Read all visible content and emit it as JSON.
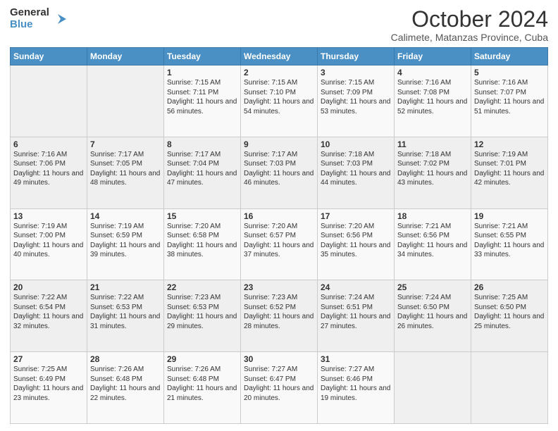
{
  "logo": {
    "line1": "General",
    "line2": "Blue",
    "icon_color": "#4a90c4"
  },
  "header": {
    "month": "October 2024",
    "location": "Calimete, Matanzas Province, Cuba"
  },
  "weekdays": [
    "Sunday",
    "Monday",
    "Tuesday",
    "Wednesday",
    "Thursday",
    "Friday",
    "Saturday"
  ],
  "weeks": [
    [
      {
        "day": "",
        "info": ""
      },
      {
        "day": "",
        "info": ""
      },
      {
        "day": "1",
        "info": "Sunrise: 7:15 AM\nSunset: 7:11 PM\nDaylight: 11 hours and 56 minutes."
      },
      {
        "day": "2",
        "info": "Sunrise: 7:15 AM\nSunset: 7:10 PM\nDaylight: 11 hours and 54 minutes."
      },
      {
        "day": "3",
        "info": "Sunrise: 7:15 AM\nSunset: 7:09 PM\nDaylight: 11 hours and 53 minutes."
      },
      {
        "day": "4",
        "info": "Sunrise: 7:16 AM\nSunset: 7:08 PM\nDaylight: 11 hours and 52 minutes."
      },
      {
        "day": "5",
        "info": "Sunrise: 7:16 AM\nSunset: 7:07 PM\nDaylight: 11 hours and 51 minutes."
      }
    ],
    [
      {
        "day": "6",
        "info": "Sunrise: 7:16 AM\nSunset: 7:06 PM\nDaylight: 11 hours and 49 minutes."
      },
      {
        "day": "7",
        "info": "Sunrise: 7:17 AM\nSunset: 7:05 PM\nDaylight: 11 hours and 48 minutes."
      },
      {
        "day": "8",
        "info": "Sunrise: 7:17 AM\nSunset: 7:04 PM\nDaylight: 11 hours and 47 minutes."
      },
      {
        "day": "9",
        "info": "Sunrise: 7:17 AM\nSunset: 7:03 PM\nDaylight: 11 hours and 46 minutes."
      },
      {
        "day": "10",
        "info": "Sunrise: 7:18 AM\nSunset: 7:03 PM\nDaylight: 11 hours and 44 minutes."
      },
      {
        "day": "11",
        "info": "Sunrise: 7:18 AM\nSunset: 7:02 PM\nDaylight: 11 hours and 43 minutes."
      },
      {
        "day": "12",
        "info": "Sunrise: 7:19 AM\nSunset: 7:01 PM\nDaylight: 11 hours and 42 minutes."
      }
    ],
    [
      {
        "day": "13",
        "info": "Sunrise: 7:19 AM\nSunset: 7:00 PM\nDaylight: 11 hours and 40 minutes."
      },
      {
        "day": "14",
        "info": "Sunrise: 7:19 AM\nSunset: 6:59 PM\nDaylight: 11 hours and 39 minutes."
      },
      {
        "day": "15",
        "info": "Sunrise: 7:20 AM\nSunset: 6:58 PM\nDaylight: 11 hours and 38 minutes."
      },
      {
        "day": "16",
        "info": "Sunrise: 7:20 AM\nSunset: 6:57 PM\nDaylight: 11 hours and 37 minutes."
      },
      {
        "day": "17",
        "info": "Sunrise: 7:20 AM\nSunset: 6:56 PM\nDaylight: 11 hours and 35 minutes."
      },
      {
        "day": "18",
        "info": "Sunrise: 7:21 AM\nSunset: 6:56 PM\nDaylight: 11 hours and 34 minutes."
      },
      {
        "day": "19",
        "info": "Sunrise: 7:21 AM\nSunset: 6:55 PM\nDaylight: 11 hours and 33 minutes."
      }
    ],
    [
      {
        "day": "20",
        "info": "Sunrise: 7:22 AM\nSunset: 6:54 PM\nDaylight: 11 hours and 32 minutes."
      },
      {
        "day": "21",
        "info": "Sunrise: 7:22 AM\nSunset: 6:53 PM\nDaylight: 11 hours and 31 minutes."
      },
      {
        "day": "22",
        "info": "Sunrise: 7:23 AM\nSunset: 6:53 PM\nDaylight: 11 hours and 29 minutes."
      },
      {
        "day": "23",
        "info": "Sunrise: 7:23 AM\nSunset: 6:52 PM\nDaylight: 11 hours and 28 minutes."
      },
      {
        "day": "24",
        "info": "Sunrise: 7:24 AM\nSunset: 6:51 PM\nDaylight: 11 hours and 27 minutes."
      },
      {
        "day": "25",
        "info": "Sunrise: 7:24 AM\nSunset: 6:50 PM\nDaylight: 11 hours and 26 minutes."
      },
      {
        "day": "26",
        "info": "Sunrise: 7:25 AM\nSunset: 6:50 PM\nDaylight: 11 hours and 25 minutes."
      }
    ],
    [
      {
        "day": "27",
        "info": "Sunrise: 7:25 AM\nSunset: 6:49 PM\nDaylight: 11 hours and 23 minutes."
      },
      {
        "day": "28",
        "info": "Sunrise: 7:26 AM\nSunset: 6:48 PM\nDaylight: 11 hours and 22 minutes."
      },
      {
        "day": "29",
        "info": "Sunrise: 7:26 AM\nSunset: 6:48 PM\nDaylight: 11 hours and 21 minutes."
      },
      {
        "day": "30",
        "info": "Sunrise: 7:27 AM\nSunset: 6:47 PM\nDaylight: 11 hours and 20 minutes."
      },
      {
        "day": "31",
        "info": "Sunrise: 7:27 AM\nSunset: 6:46 PM\nDaylight: 11 hours and 19 minutes."
      },
      {
        "day": "",
        "info": ""
      },
      {
        "day": "",
        "info": ""
      }
    ]
  ]
}
